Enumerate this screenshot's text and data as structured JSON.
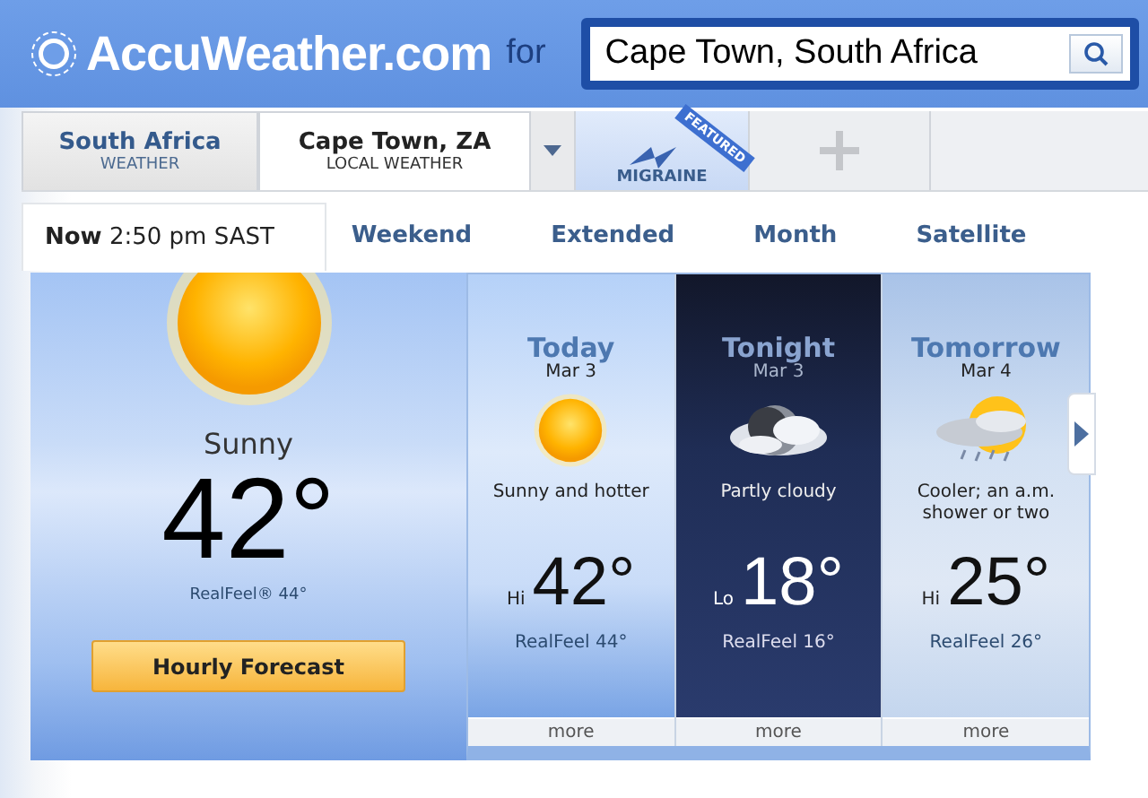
{
  "header": {
    "logo": "AccuWeather.com",
    "for_label": "for",
    "search": {
      "value": "Cape Town, South Africa"
    }
  },
  "location_tabs": [
    {
      "title": "South Africa",
      "subtitle": "WEATHER",
      "selected": false
    },
    {
      "title": "Cape Town, ZA",
      "subtitle": "LOCAL WEATHER",
      "selected": true
    }
  ],
  "featured_tab": {
    "label": "MIGRAINE",
    "ribbon": "FEATURED"
  },
  "nav_tabs": [
    {
      "label": "**Now** 2:50 pm SAST",
      "selected": true
    },
    {
      "label": "Weekend",
      "selected": false
    },
    {
      "label": "Extended",
      "selected": false
    },
    {
      "label": "Month",
      "selected": false
    },
    {
      "label": "Satellite",
      "selected": false
    }
  ],
  "current": {
    "condition": "Sunny",
    "temperature": "42°",
    "realfeel": "RealFeel® 44°",
    "button": "Hourly Forecast"
  },
  "forecast": [
    {
      "kind": "day",
      "period": "Today",
      "date": "Mar 3",
      "condition": "Sunny and hotter",
      "hilo": "Hi",
      "temperature": "42°",
      "realfeel": "RealFeel 44°",
      "more": "more"
    },
    {
      "kind": "night",
      "period": "Tonight",
      "date": "Mar 3",
      "condition": "Partly cloudy",
      "hilo": "Lo",
      "temperature": "18°",
      "realfeel": "RealFeel 16°",
      "more": "more"
    },
    {
      "kind": "showers",
      "period": "Tomorrow",
      "date": "Mar 4",
      "condition": "Cooler; an a.m. shower or two",
      "hilo": "Hi",
      "temperature": "25°",
      "realfeel": "RealFeel 26°",
      "more": "more"
    }
  ]
}
